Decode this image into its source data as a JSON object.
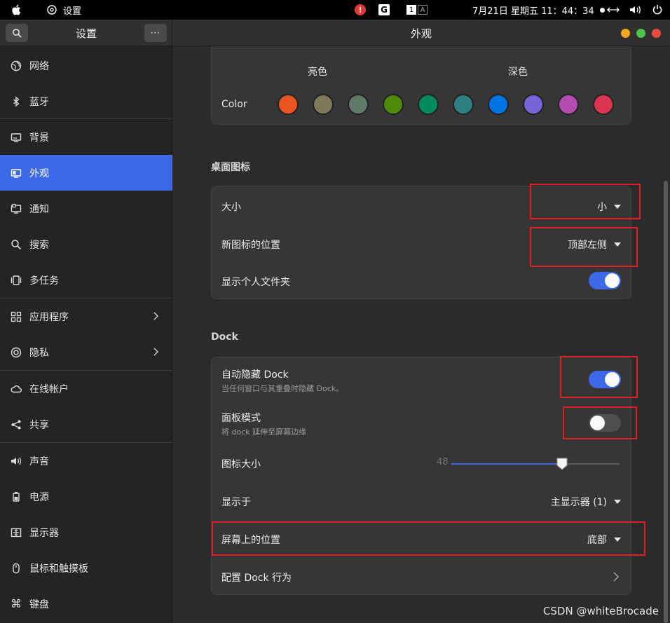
{
  "topbar": {
    "app_name": "设置",
    "indicator_alert": "!",
    "indicator_g": "G",
    "kb_1": "1",
    "kb_a": "A",
    "clock": "7月21日 星期五  11：44：34"
  },
  "header": {
    "sidebar_title": "设置",
    "menu_label": "⋯",
    "main_title": "外观"
  },
  "sidebar": {
    "items": [
      {
        "label": "网络",
        "icon": "globe-icon"
      },
      {
        "label": "蓝牙",
        "icon": "bluetooth-icon"
      },
      {
        "label": "背景",
        "icon": "monitor-icon"
      },
      {
        "label": "外观",
        "icon": "appearance-icon",
        "active": true
      },
      {
        "label": "通知",
        "icon": "notification-icon"
      },
      {
        "label": "搜索",
        "icon": "search-icon"
      },
      {
        "label": "多任务",
        "icon": "multitask-icon"
      },
      {
        "label": "应用程序",
        "icon": "apps-icon",
        "chevron": true
      },
      {
        "label": "隐私",
        "icon": "privacy-icon",
        "chevron": true
      },
      {
        "label": "在线帐户",
        "icon": "cloud-icon"
      },
      {
        "label": "共享",
        "icon": "share-icon"
      },
      {
        "label": "声音",
        "icon": "sound-icon"
      },
      {
        "label": "电源",
        "icon": "power-icon"
      },
      {
        "label": "显示器",
        "icon": "display-icon"
      },
      {
        "label": "鼠标和触摸板",
        "icon": "mouse-icon"
      },
      {
        "label": "键盘",
        "icon": "keyboard-icon"
      }
    ]
  },
  "style": {
    "light_label": "亮色",
    "dark_label": "深色",
    "color_label": "Color",
    "swatches": [
      "#e95420",
      "#7e7a5b",
      "#5f7a69",
      "#4e8a07",
      "#038a5f",
      "#2e7f82",
      "#0273e3",
      "#7764d8",
      "#b34cb3",
      "#da3450"
    ]
  },
  "desktop_icons": {
    "title": "桌面图标",
    "size_label": "大小",
    "size_value": "小",
    "position_label": "新图标的位置",
    "position_value": "顶部左侧",
    "home_folder_label": "显示个人文件夹",
    "home_folder_on": true
  },
  "dock": {
    "title": "Dock",
    "autohide_label": "自动隐藏 Dock",
    "autohide_sub": "当任何窗口与其重叠时隐藏 Dock。",
    "autohide_on": true,
    "panel_label": "面板模式",
    "panel_sub": "将 dock 延伸至屏幕边缘",
    "panel_on": false,
    "icon_size_label": "图标大小",
    "icon_size_value": "48",
    "icon_size_fraction": 0.66,
    "show_on_label": "显示于",
    "show_on_value": "主显示器 (1)",
    "screen_position_label": "屏幕上的位置",
    "screen_position_value": "底部",
    "configure_label": "配置 Dock 行为"
  },
  "watermark": "CSDN @whiteBrocade"
}
